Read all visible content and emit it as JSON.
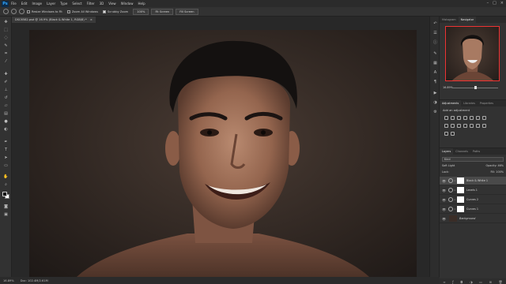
{
  "menubar": {
    "logo": "Ps",
    "items": [
      "File",
      "Edit",
      "Image",
      "Layer",
      "Type",
      "Select",
      "Filter",
      "3D",
      "View",
      "Window",
      "Help"
    ],
    "window_controls": [
      "–",
      "□",
      "×"
    ]
  },
  "options": {
    "resize_windows": "Resize Windows to Fit",
    "zoom_all": "Zoom All Windows",
    "scrubby": "Scrubby Zoom",
    "zoom_value": "100%",
    "fit_screen": "Fit Screen",
    "fill_screen": "Fill Screen"
  },
  "document": {
    "tab_title": "DSC6582.psd @ 16.9% (Black & White 1, RGB/8) *",
    "tab_close": "×"
  },
  "status": {
    "zoom": "16.89%",
    "doc_size": "Doc: 102.4M/2.61M"
  },
  "navigator": {
    "tabs": [
      "Histogram",
      "Navigator"
    ],
    "zoom": "16.89%"
  },
  "adjustments": {
    "tabs": [
      "Adjustments",
      "Libraries",
      "Properties"
    ],
    "title": "Add an adjustment"
  },
  "layers": {
    "tabs": [
      "Layers",
      "Channels",
      "Paths"
    ],
    "filter_label": "Kind",
    "blend_mode": "Soft Light",
    "opacity_label": "Opacity:",
    "opacity_value": "46%",
    "lock_label": "Lock:",
    "fill_label": "Fill:",
    "fill_value": "100%",
    "items": [
      {
        "name": "Black & White 1",
        "type": "adjustment"
      },
      {
        "name": "Levels 1",
        "type": "adjustment"
      },
      {
        "name": "Curves 2",
        "type": "adjustment"
      },
      {
        "name": "Curves 1",
        "type": "adjustment"
      },
      {
        "name": "Background",
        "type": "image"
      }
    ],
    "footer_icons": [
      "link-icon",
      "fx-icon",
      "mask-icon",
      "adjustment-icon",
      "folder-icon",
      "new-layer-icon",
      "trash-icon"
    ]
  },
  "tools": [
    "move-tool-icon",
    "marquee-tool-icon",
    "lasso-tool-icon",
    "quick-select-icon",
    "crop-tool-icon",
    "eyedropper-icon",
    "healing-brush-icon",
    "brush-tool-icon",
    "clone-stamp-icon",
    "history-brush-icon",
    "eraser-icon",
    "gradient-tool-icon",
    "blur-tool-icon",
    "dodge-tool-icon",
    "pen-tool-icon",
    "type-tool-icon",
    "path-select-icon",
    "shape-tool-icon",
    "hand-tool-icon",
    "zoom-tool-icon"
  ],
  "colors": {
    "accent": "#31a8ff",
    "nav_frame": "#e33333",
    "foreground": "#000000",
    "background": "#ffffff"
  }
}
